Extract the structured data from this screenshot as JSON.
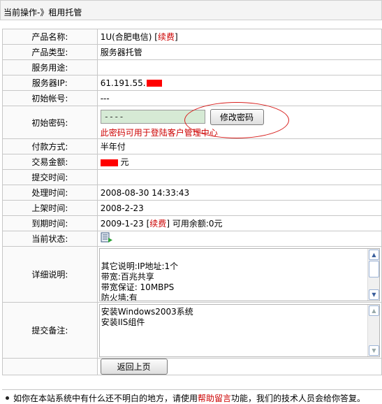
{
  "breadcrumb": "当前操作-》租用托管",
  "fields": {
    "product_name_label": "产品名称:",
    "product_name": "1U(合肥电信)",
    "renew_link": "续费",
    "product_type_label": "产品类型:",
    "product_type": "服务器托管",
    "usage_label": "服务用途:",
    "usage": "",
    "ip_label": "服务器IP:",
    "ip": "61.191.55.",
    "account_label": "初始帐号:",
    "account": "---",
    "password_label": "初始密码:",
    "password_value": "----",
    "change_password_button": "修改密码",
    "password_note": "此密码可用于登陆客户管理中心",
    "payment_label": "付款方式:",
    "payment": "半年付",
    "amount_label": "交易金额:",
    "amount_unit": "元",
    "submit_time_label": "提交时间:",
    "submit_time": "",
    "process_time_label": "处理时间:",
    "process_time": "2008-08-30 14:33:43",
    "shelf_time_label": "上架时间:",
    "shelf_time": "2008-2-23",
    "expire_label": "到期时间:",
    "expire_date": "2009-1-23",
    "expire_renew": "续费",
    "balance_text": "可用余额:0元",
    "status_label": "当前状态:",
    "status_icon": "server-status-icon",
    "details_label": "详细说明:",
    "details_text": "其它说明:IP地址:1个\n带宽:百兆共享\n带宽保证: 10MBPS\n防火墙:有",
    "remarks_label": "提交备注:",
    "remarks_text": "安装Windows2003系统\n安装IIS组件",
    "back_button": "返回上页"
  },
  "footer": {
    "text_before": "如你在本站系统中有什么还不明白的地方，请使用",
    "link": "帮助留言",
    "text_after": "功能，我们的技术人员会给你答复。"
  },
  "colors": {
    "accent_red": "#cc0000",
    "redact": "#ff0000",
    "password_bg": "#d6ead5"
  }
}
